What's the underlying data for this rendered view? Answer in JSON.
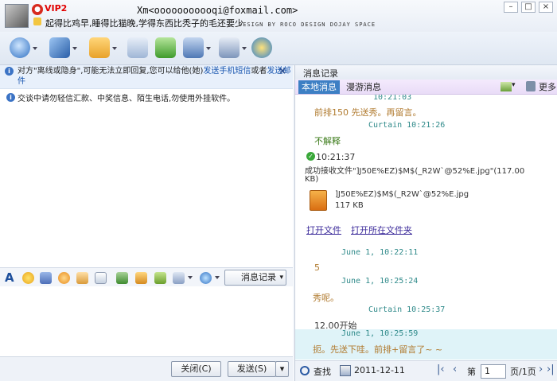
{
  "header": {
    "vip_label": "VIP2",
    "email": "Xm<ooooooooooqi@foxmail.com>",
    "status": "起得比鸡早,睡得比猫晚,学得东西比秃子的毛还要少",
    "watermark": "DESIGN BY ROCO DESIGN DOJAY SPACE"
  },
  "notice": {
    "text_prefix": "对方\"离线或隐身\",可能无法立即回复,您可以给他(她)",
    "send_sms": "发送手机短信",
    "or": "或者",
    "send_email": "发送邮件",
    "security": "交谈中请勿轻信汇款、中奖信息、陌生电话,勿使用外挂软件。"
  },
  "format_bar": {
    "message_log": "消息记录"
  },
  "buttons": {
    "close": "关闭(C)",
    "send": "发送(S)"
  },
  "history": {
    "title": "消息记录",
    "tabs": [
      "本地消息",
      "漫游消息"
    ],
    "more": "更多",
    "lines": {
      "l0": "10:21:03",
      "l1": "前排150 先送秀。再留言。",
      "l2": "Curtain 10:21:26",
      "l3": "不解释",
      "l4": "10:21:37",
      "l5": "成功接收文件\"]J50E%EZ)$M$(_R2W`@52%E.jpg\"(117.00",
      "l5b": "KB)",
      "file_name": "]J50E%EZ)$M$(_R2W`@52%E.jpg",
      "file_size": "117 KB",
      "open_file": "打开文件",
      "open_folder": "打开所在文件夹",
      "l6": "June 1,    10:22:11",
      "l7": "5",
      "l8": "June 1,    10:25:24",
      "l9": "秀呢。",
      "l10": "Curtain 10:25:37",
      "l11": "12.00开始",
      "l12": "June 1,    10:25:59",
      "l13": "扼。先送下哇。前排+留言了~ ~"
    },
    "footer": {
      "search": "查找",
      "date": "2011-12-11",
      "page_prefix": "第",
      "page": "1",
      "page_suffix": "页/1页"
    }
  }
}
